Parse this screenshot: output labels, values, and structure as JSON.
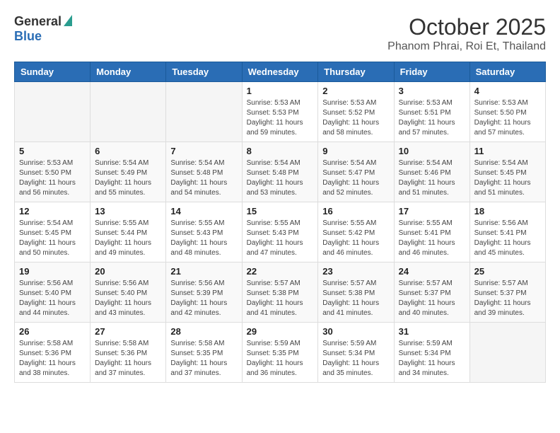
{
  "header": {
    "logo_general": "General",
    "logo_blue": "Blue",
    "month_title": "October 2025",
    "location": "Phanom Phrai, Roi Et, Thailand"
  },
  "days_of_week": [
    "Sunday",
    "Monday",
    "Tuesday",
    "Wednesday",
    "Thursday",
    "Friday",
    "Saturday"
  ],
  "weeks": [
    [
      {
        "day": "",
        "info": ""
      },
      {
        "day": "",
        "info": ""
      },
      {
        "day": "",
        "info": ""
      },
      {
        "day": "1",
        "sunrise": "5:53 AM",
        "sunset": "5:53 PM",
        "daylight": "11 hours and 59 minutes."
      },
      {
        "day": "2",
        "sunrise": "5:53 AM",
        "sunset": "5:52 PM",
        "daylight": "11 hours and 58 minutes."
      },
      {
        "day": "3",
        "sunrise": "5:53 AM",
        "sunset": "5:51 PM",
        "daylight": "11 hours and 57 minutes."
      },
      {
        "day": "4",
        "sunrise": "5:53 AM",
        "sunset": "5:50 PM",
        "daylight": "11 hours and 57 minutes."
      }
    ],
    [
      {
        "day": "5",
        "sunrise": "5:53 AM",
        "sunset": "5:50 PM",
        "daylight": "11 hours and 56 minutes."
      },
      {
        "day": "6",
        "sunrise": "5:54 AM",
        "sunset": "5:49 PM",
        "daylight": "11 hours and 55 minutes."
      },
      {
        "day": "7",
        "sunrise": "5:54 AM",
        "sunset": "5:48 PM",
        "daylight": "11 hours and 54 minutes."
      },
      {
        "day": "8",
        "sunrise": "5:54 AM",
        "sunset": "5:48 PM",
        "daylight": "11 hours and 53 minutes."
      },
      {
        "day": "9",
        "sunrise": "5:54 AM",
        "sunset": "5:47 PM",
        "daylight": "11 hours and 52 minutes."
      },
      {
        "day": "10",
        "sunrise": "5:54 AM",
        "sunset": "5:46 PM",
        "daylight": "11 hours and 51 minutes."
      },
      {
        "day": "11",
        "sunrise": "5:54 AM",
        "sunset": "5:45 PM",
        "daylight": "11 hours and 51 minutes."
      }
    ],
    [
      {
        "day": "12",
        "sunrise": "5:54 AM",
        "sunset": "5:45 PM",
        "daylight": "11 hours and 50 minutes."
      },
      {
        "day": "13",
        "sunrise": "5:55 AM",
        "sunset": "5:44 PM",
        "daylight": "11 hours and 49 minutes."
      },
      {
        "day": "14",
        "sunrise": "5:55 AM",
        "sunset": "5:43 PM",
        "daylight": "11 hours and 48 minutes."
      },
      {
        "day": "15",
        "sunrise": "5:55 AM",
        "sunset": "5:43 PM",
        "daylight": "11 hours and 47 minutes."
      },
      {
        "day": "16",
        "sunrise": "5:55 AM",
        "sunset": "5:42 PM",
        "daylight": "11 hours and 46 minutes."
      },
      {
        "day": "17",
        "sunrise": "5:55 AM",
        "sunset": "5:41 PM",
        "daylight": "11 hours and 46 minutes."
      },
      {
        "day": "18",
        "sunrise": "5:56 AM",
        "sunset": "5:41 PM",
        "daylight": "11 hours and 45 minutes."
      }
    ],
    [
      {
        "day": "19",
        "sunrise": "5:56 AM",
        "sunset": "5:40 PM",
        "daylight": "11 hours and 44 minutes."
      },
      {
        "day": "20",
        "sunrise": "5:56 AM",
        "sunset": "5:40 PM",
        "daylight": "11 hours and 43 minutes."
      },
      {
        "day": "21",
        "sunrise": "5:56 AM",
        "sunset": "5:39 PM",
        "daylight": "11 hours and 42 minutes."
      },
      {
        "day": "22",
        "sunrise": "5:57 AM",
        "sunset": "5:38 PM",
        "daylight": "11 hours and 41 minutes."
      },
      {
        "day": "23",
        "sunrise": "5:57 AM",
        "sunset": "5:38 PM",
        "daylight": "11 hours and 41 minutes."
      },
      {
        "day": "24",
        "sunrise": "5:57 AM",
        "sunset": "5:37 PM",
        "daylight": "11 hours and 40 minutes."
      },
      {
        "day": "25",
        "sunrise": "5:57 AM",
        "sunset": "5:37 PM",
        "daylight": "11 hours and 39 minutes."
      }
    ],
    [
      {
        "day": "26",
        "sunrise": "5:58 AM",
        "sunset": "5:36 PM",
        "daylight": "11 hours and 38 minutes."
      },
      {
        "day": "27",
        "sunrise": "5:58 AM",
        "sunset": "5:36 PM",
        "daylight": "11 hours and 37 minutes."
      },
      {
        "day": "28",
        "sunrise": "5:58 AM",
        "sunset": "5:35 PM",
        "daylight": "11 hours and 37 minutes."
      },
      {
        "day": "29",
        "sunrise": "5:59 AM",
        "sunset": "5:35 PM",
        "daylight": "11 hours and 36 minutes."
      },
      {
        "day": "30",
        "sunrise": "5:59 AM",
        "sunset": "5:34 PM",
        "daylight": "11 hours and 35 minutes."
      },
      {
        "day": "31",
        "sunrise": "5:59 AM",
        "sunset": "5:34 PM",
        "daylight": "11 hours and 34 minutes."
      },
      {
        "day": "",
        "info": ""
      }
    ]
  ],
  "labels": {
    "sunrise": "Sunrise:",
    "sunset": "Sunset:",
    "daylight": "Daylight:"
  }
}
